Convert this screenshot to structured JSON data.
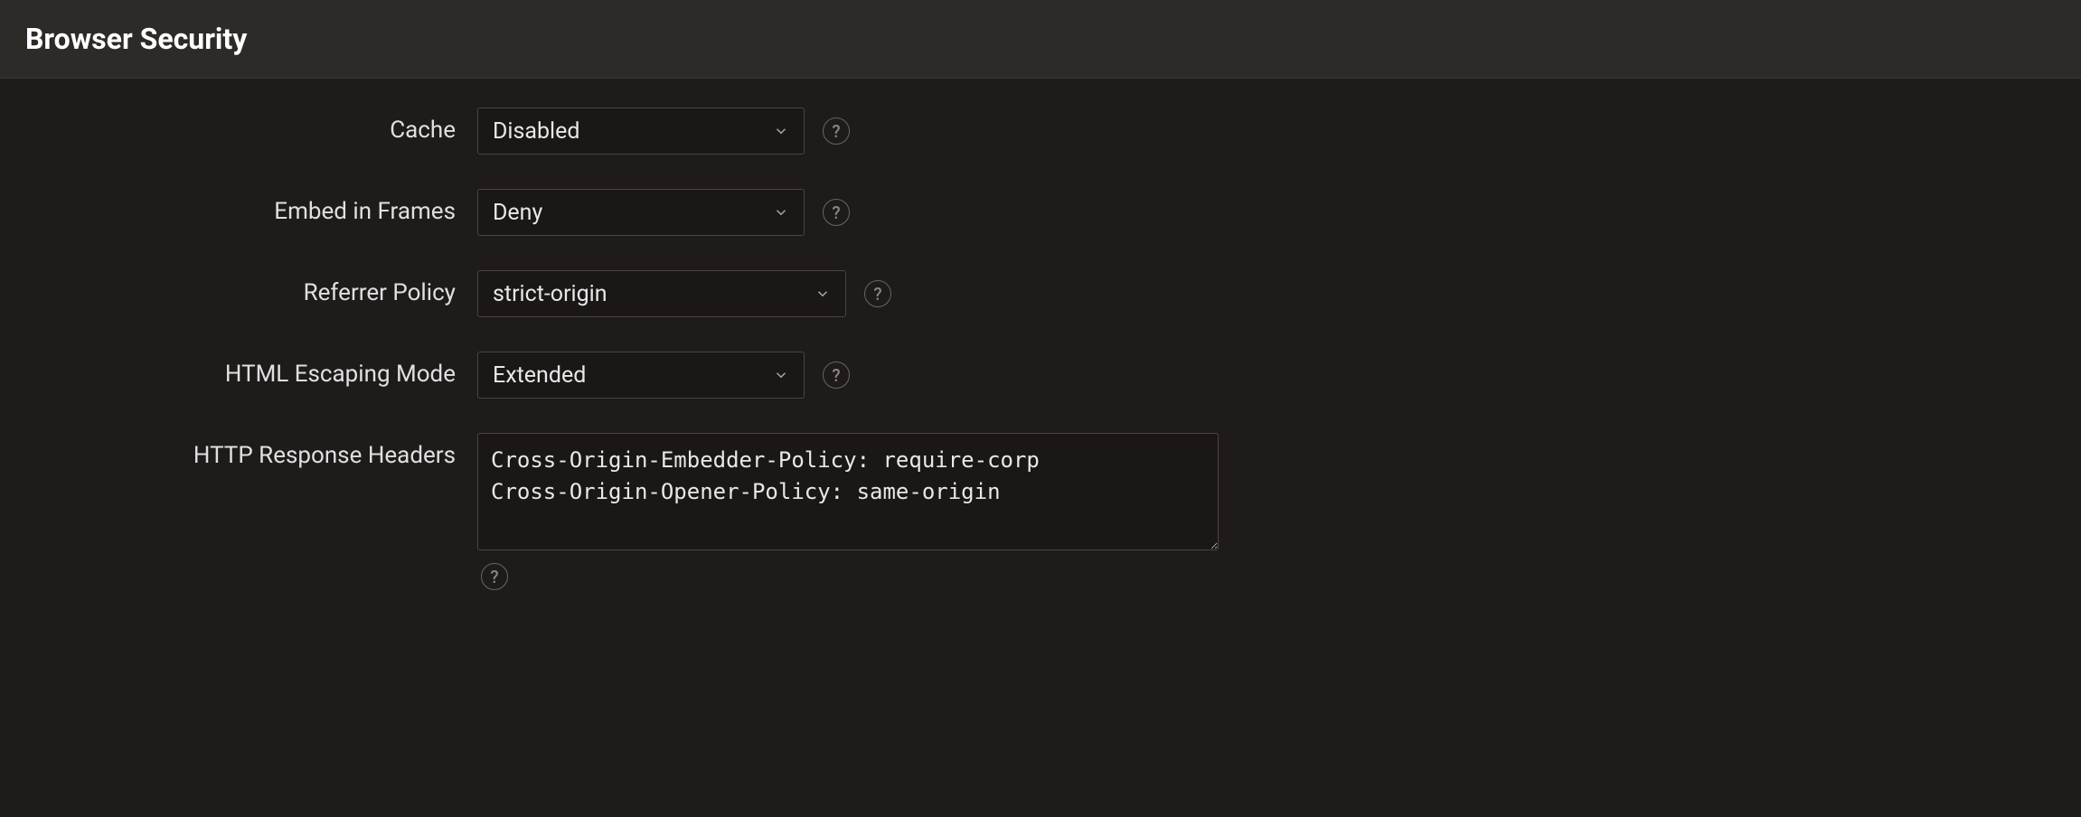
{
  "header": {
    "title": "Browser Security"
  },
  "form": {
    "cache": {
      "label": "Cache",
      "value": "Disabled"
    },
    "embed_in_frames": {
      "label": "Embed in Frames",
      "value": "Deny"
    },
    "referrer_policy": {
      "label": "Referrer Policy",
      "value": "strict-origin"
    },
    "html_escaping_mode": {
      "label": "HTML Escaping Mode",
      "value": "Extended"
    },
    "http_response_headers": {
      "label": "HTTP Response Headers",
      "value": "Cross-Origin-Embedder-Policy: require-corp\nCross-Origin-Opener-Policy: same-origin"
    }
  },
  "icons": {
    "help_glyph": "?"
  }
}
